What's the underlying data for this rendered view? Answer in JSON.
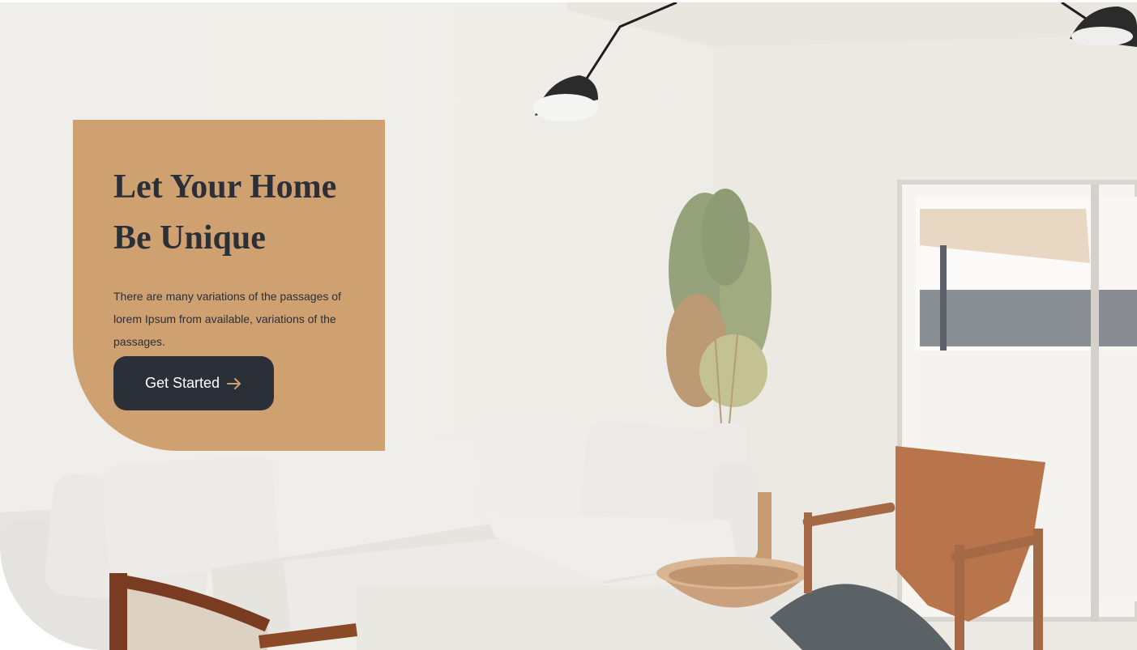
{
  "hero": {
    "title_line1": "Let Your Home",
    "title_line2": "Be Unique",
    "description": "There are many variations of the passages of lorem Ipsum from available, variations of the passages.",
    "cta_label": "Get Started",
    "cta_icon": "arrow-right-icon"
  },
  "colors": {
    "card_background": "#cfa070",
    "heading_text": "#2b2f38",
    "button_background": "#2a2f38",
    "button_text": "#ffffff",
    "arrow_accent": "#cfa070"
  }
}
